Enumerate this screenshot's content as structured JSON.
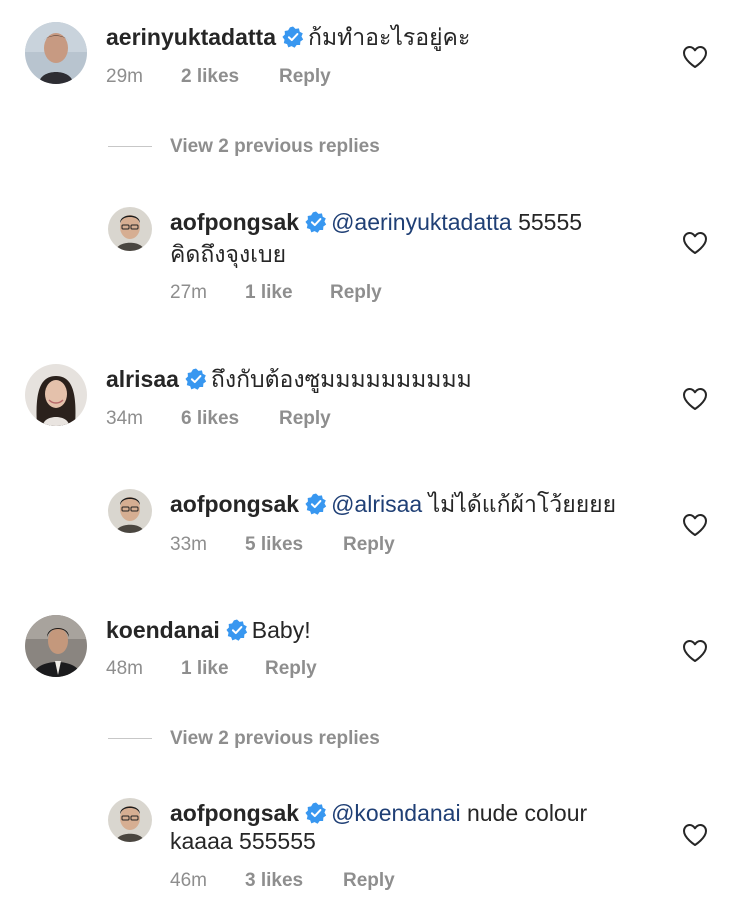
{
  "comments": [
    {
      "username": "aerinyuktadatta",
      "text": "ก้มทำอะไรอยู่คะ",
      "time": "29m",
      "likes": "2 likes",
      "reply": "Reply"
    },
    {
      "view_replies": "View 2 previous replies"
    },
    {
      "username": "aofpongsak",
      "mention": "@aerinyuktadatta",
      "text": " 55555",
      "text2": "คิดถึงจุงเบย",
      "time": "27m",
      "likes": "1 like",
      "reply": "Reply"
    },
    {
      "username": "alrisaa",
      "text": "ถึงกับต้องซูมมมมมมมมมม",
      "time": "34m",
      "likes": "6 likes",
      "reply": "Reply"
    },
    {
      "username": "aofpongsak",
      "mention": "@alrisaa",
      "text": " ไม่ได้แก้ผ้าโว้ยยยย",
      "time": "33m",
      "likes": "5 likes",
      "reply": "Reply"
    },
    {
      "username": "koendanai",
      "text": "Baby!",
      "time": "48m",
      "likes": "1 like",
      "reply": "Reply"
    },
    {
      "view_replies": "View 2 previous replies"
    },
    {
      "username": "aofpongsak",
      "mention": "@koendanai",
      "text": " nude colour",
      "text2": "kaaaa 555555",
      "time": "46m",
      "likes": "3 likes",
      "reply": "Reply"
    }
  ],
  "colors": {
    "verified": "#3897f0",
    "mention": "#1f3f75",
    "meta": "#8e8e8e"
  },
  "icons": {
    "verified": "verified-badge-icon",
    "like": "heart-outline-icon"
  }
}
